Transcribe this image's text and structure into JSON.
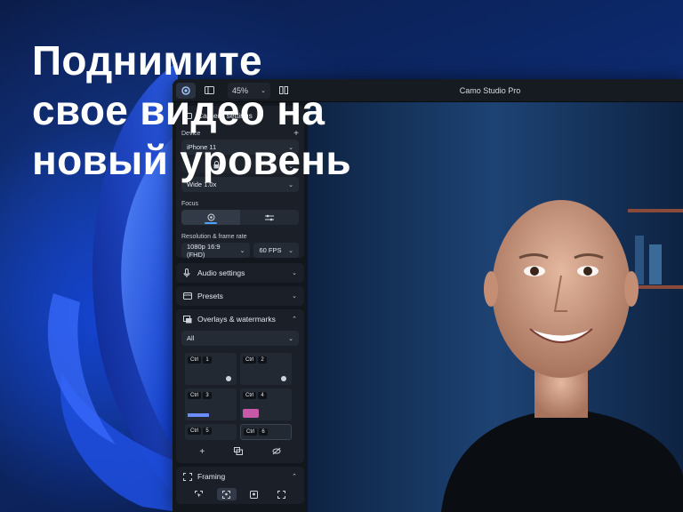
{
  "headline": [
    "Поднимите",
    "свое видео на",
    "новый уровень"
  ],
  "titlebar": {
    "zoom": "45%",
    "title": "Camo Studio Pro"
  },
  "camera": {
    "section_label": "Camera settings",
    "device_label": "Device",
    "device_value": "iPhone 11",
    "lens_value": "Wide 1.0x",
    "focus_label": "Focus",
    "resolution_label": "Resolution & frame rate",
    "resolution_value": "1080p 16:9 (FHD)",
    "fps_value": "60 FPS"
  },
  "sections": {
    "audio": "Audio settings",
    "presets": "Presets",
    "overlays": "Overlays & watermarks",
    "framing": "Framing"
  },
  "overlays": {
    "filter_value": "All",
    "tiles": [
      {
        "mod": "Ctrl",
        "key": "1"
      },
      {
        "mod": "Ctrl",
        "key": "2"
      },
      {
        "mod": "Ctrl",
        "key": "3"
      },
      {
        "mod": "Ctrl",
        "key": "4"
      },
      {
        "mod": "Ctrl",
        "key": "5"
      },
      {
        "mod": "Ctrl",
        "key": "6"
      }
    ]
  },
  "colors": {
    "accent": "#4aa3ff",
    "panel": "#1b2028",
    "window": "#0e1218"
  }
}
